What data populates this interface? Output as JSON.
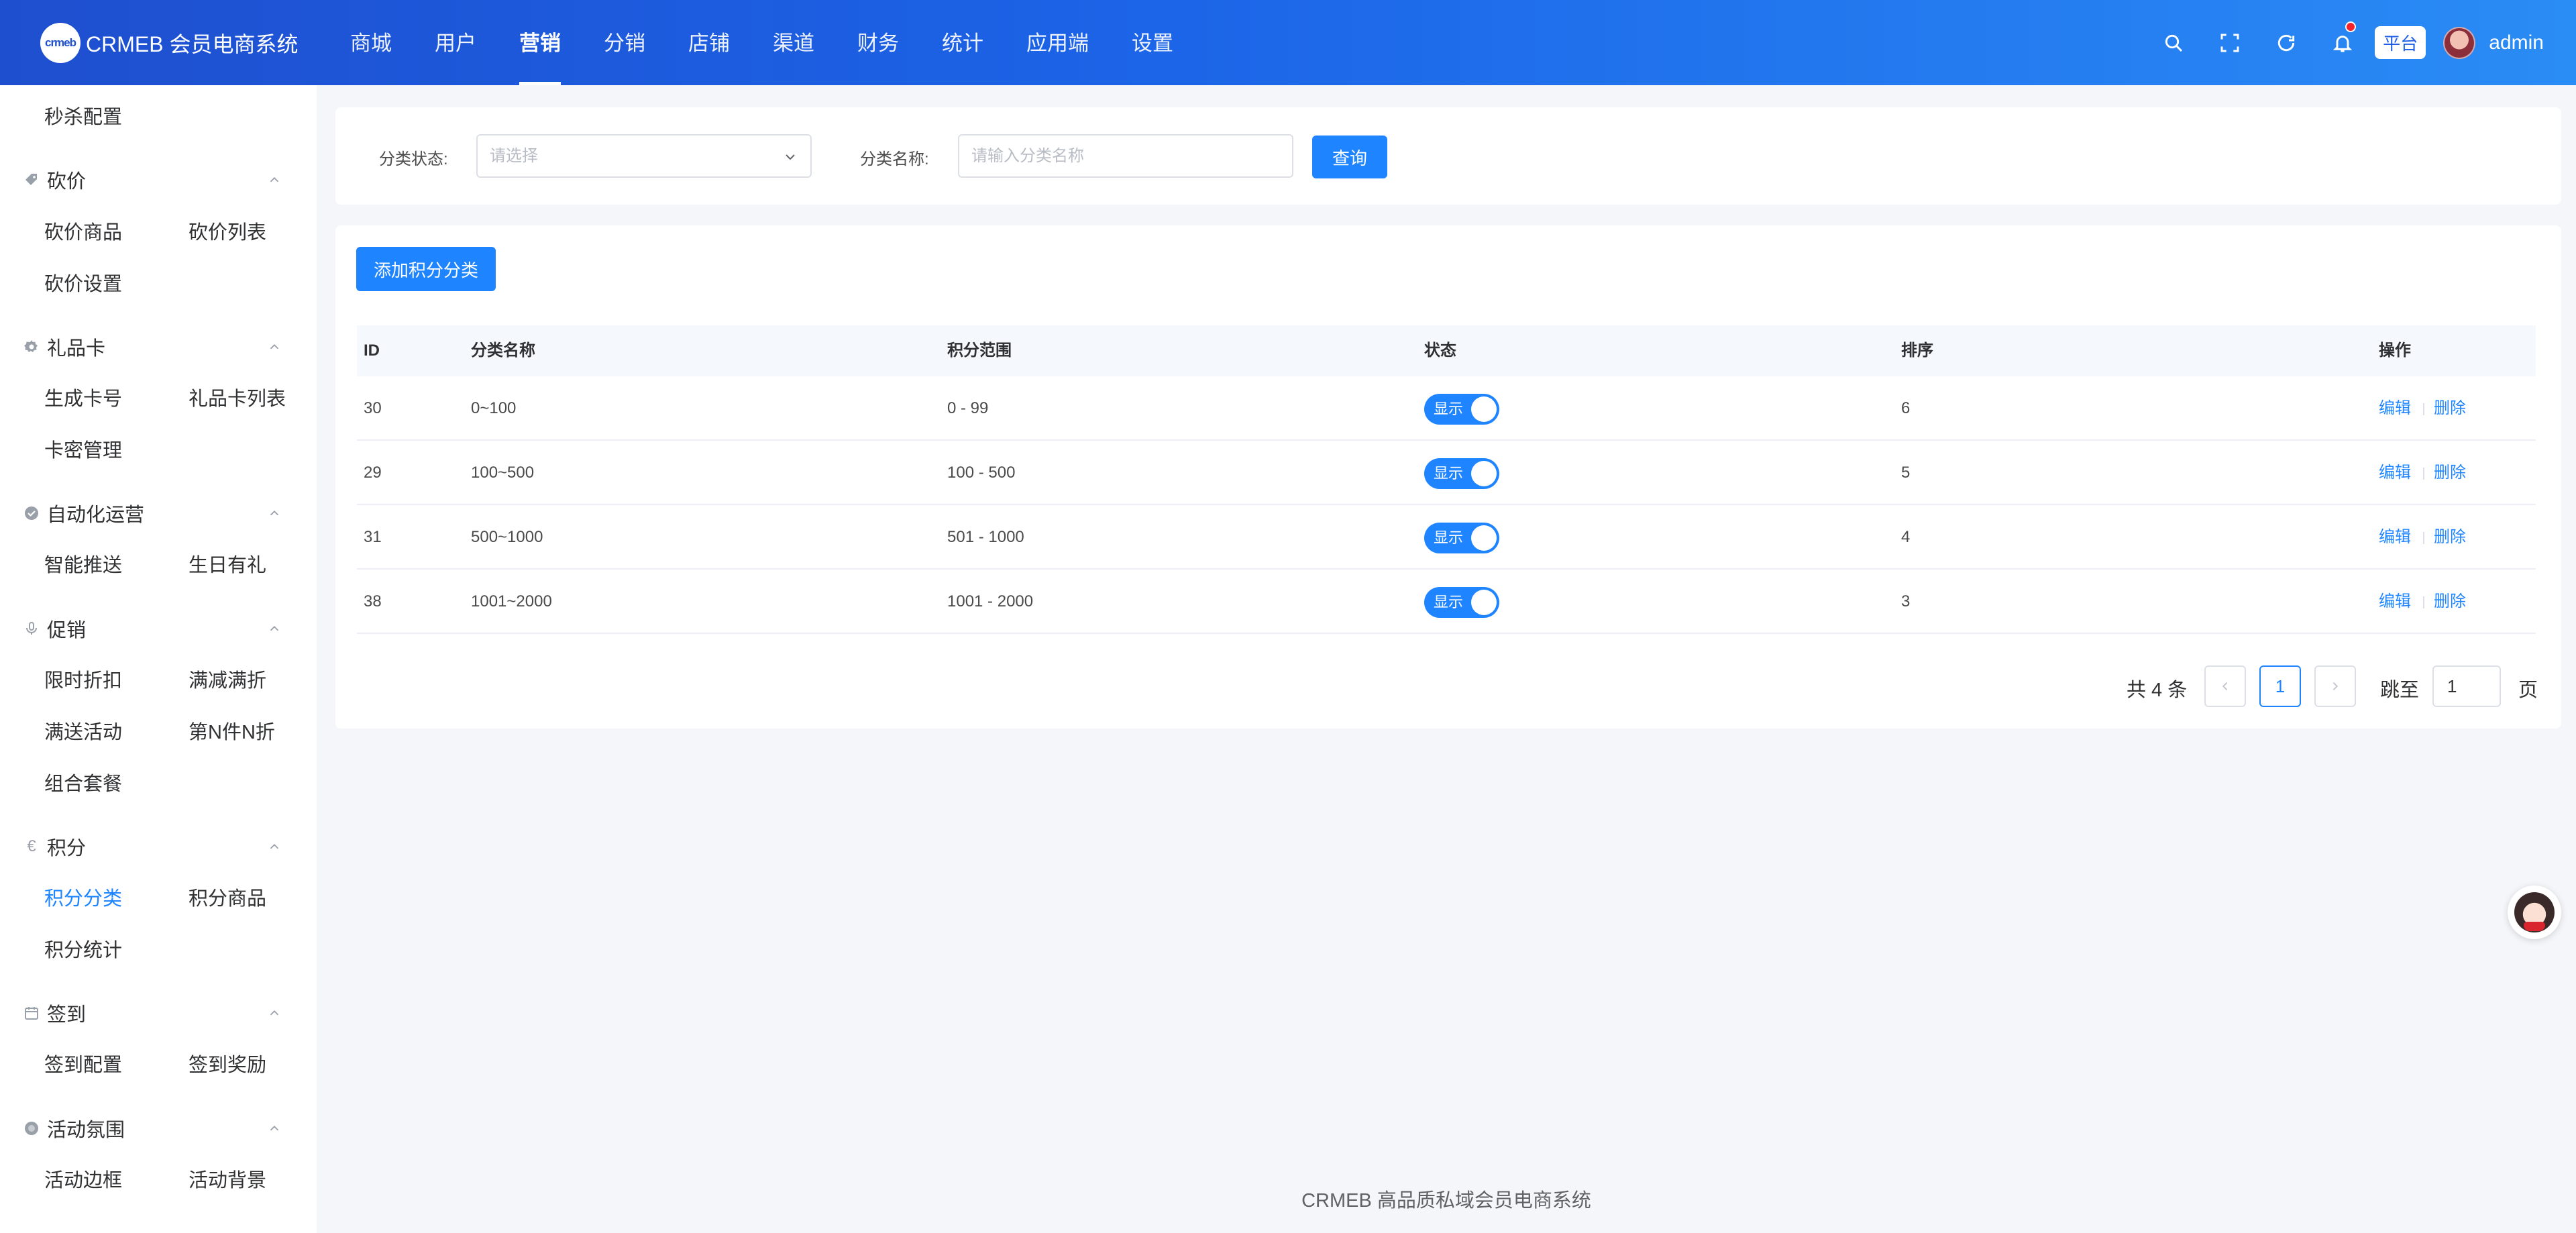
{
  "header": {
    "logo_mark": "crmeb",
    "app_title": "CRMEB 会员电商系统",
    "nav": [
      "商城",
      "用户",
      "营销",
      "分销",
      "店铺",
      "渠道",
      "财务",
      "统计",
      "应用端",
      "设置"
    ],
    "active_nav": "营销",
    "platform_tag": "平台",
    "username": "admin",
    "icons": [
      "search-icon",
      "fullscreen-icon",
      "refresh-icon",
      "bell-icon"
    ]
  },
  "sidebar": {
    "top_item": "秒杀配置",
    "groups": [
      {
        "title": "砍价",
        "icon": "tag-icon",
        "items": [
          "砍价商品",
          "砍价列表",
          "砍价设置"
        ]
      },
      {
        "title": "礼品卡",
        "icon": "gear-icon",
        "items": [
          "生成卡号",
          "礼品卡列表",
          "卡密管理"
        ]
      },
      {
        "title": "自动化运营",
        "icon": "check-circle-icon",
        "items": [
          "智能推送",
          "生日有礼"
        ]
      },
      {
        "title": "促销",
        "icon": "mic-icon",
        "items": [
          "限时折扣",
          "满减满折",
          "满送活动",
          "第N件N折",
          "组合套餐"
        ]
      },
      {
        "title": "积分",
        "icon": "euro-icon",
        "items": [
          "积分分类",
          "积分商品",
          "积分统计"
        ]
      },
      {
        "title": "签到",
        "icon": "calendar-icon",
        "items": [
          "签到配置",
          "签到奖励"
        ]
      },
      {
        "title": "活动氛围",
        "icon": "circle-icon",
        "items": [
          "活动边框",
          "活动背景"
        ]
      }
    ],
    "active_item": "积分分类"
  },
  "filter": {
    "status_label": "分类状态:",
    "status_placeholder": "请选择",
    "name_label": "分类名称:",
    "name_placeholder": "请输入分类名称",
    "query_button": "查询"
  },
  "toolbar": {
    "add_button": "添加积分分类"
  },
  "table": {
    "columns": [
      "ID",
      "分类名称",
      "积分范围",
      "状态",
      "排序",
      "操作"
    ],
    "rows": [
      {
        "id": "30",
        "name": "0~100",
        "range": "0 - 99",
        "status": "显示",
        "sort": "6",
        "edit": "编辑",
        "delete": "删除"
      },
      {
        "id": "29",
        "name": "100~500",
        "range": "100 - 500",
        "status": "显示",
        "sort": "5",
        "edit": "编辑",
        "delete": "删除"
      },
      {
        "id": "31",
        "name": "500~1000",
        "range": "501 - 1000",
        "status": "显示",
        "sort": "4",
        "edit": "编辑",
        "delete": "删除"
      },
      {
        "id": "38",
        "name": "1001~2000",
        "range": "1001 - 2000",
        "status": "显示",
        "sort": "3",
        "edit": "编辑",
        "delete": "删除"
      }
    ]
  },
  "pagination": {
    "total_text": "共 4 条",
    "current_page": "1",
    "jump_label": "跳至",
    "jump_value": "1",
    "page_suffix": "页"
  },
  "footer": {
    "text": "CRMEB 高品质私域会员电商系统"
  },
  "colors": {
    "primary": "#1e84ff",
    "header_start": "#1e4fcf",
    "header_end": "#2a8cf5"
  }
}
